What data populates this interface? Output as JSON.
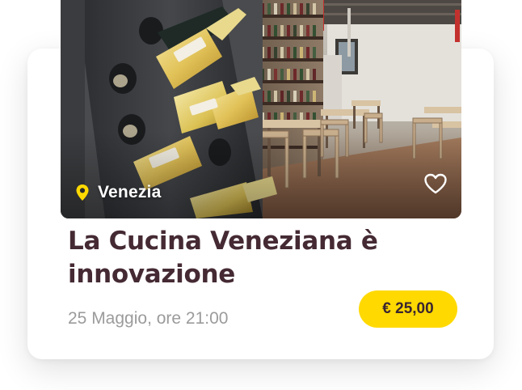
{
  "card": {
    "location": "Venezia",
    "title": "La Cucina Veneziana è innovazione",
    "date": "25 Maggio, ore 21:00",
    "price": "€ 25,00",
    "icons": {
      "location": "map-pin-icon",
      "favorite": "heart-outline-icon"
    },
    "colors": {
      "accent": "#FFD900",
      "title": "#452A33",
      "date": "#9B9B9B"
    }
  }
}
